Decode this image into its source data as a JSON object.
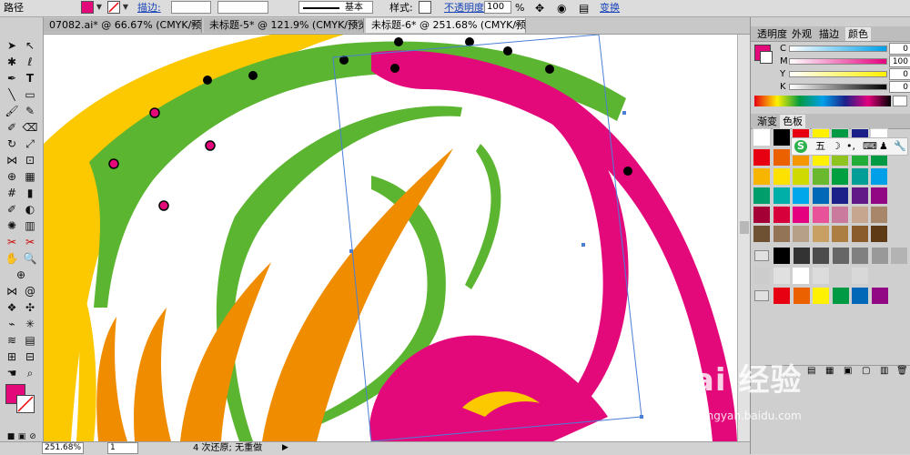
{
  "control_bar": {
    "object_type": "路径",
    "fill_color": "#e4097b",
    "stroke_label": "描边:",
    "stroke_preset": "基本",
    "style_label": "样式:",
    "opacity_label": "不透明度:",
    "opacity_value": "100",
    "opacity_unit": "%",
    "transform_label": "变换"
  },
  "tabs": [
    {
      "label": "07082.ai* @ 66.67% (CMYK/预览)",
      "active": false
    },
    {
      "label": "未标题-5* @ 121.9% (CMYK/预览)",
      "active": false
    },
    {
      "label": "未标题-6* @ 251.68% (CMYK/预览)",
      "active": true
    }
  ],
  "tab_close": "×",
  "status_bar": {
    "zoom": "251.68%",
    "page": "1",
    "message": "4 次还原; 无重做"
  },
  "panels": {
    "top_tabs": [
      "透明度",
      "外观",
      "描边",
      "颜色"
    ],
    "cmyk": [
      {
        "label": "C",
        "value": "0",
        "color": "#00a0e9"
      },
      {
        "label": "M",
        "value": "100",
        "color": "#e4007f"
      },
      {
        "label": "Y",
        "value": "0",
        "color": "#fff100"
      },
      {
        "label": "K",
        "value": "0",
        "color": "#000000"
      }
    ],
    "swatch_tabs": [
      "渐变",
      "色板"
    ],
    "ime": {
      "logo": "S",
      "mode": "五"
    }
  },
  "swatches": {
    "row1": [
      "#ffffff",
      "#000000",
      "#e60012",
      "#fff100",
      "#009944",
      "#1d2088",
      "#ffffff"
    ],
    "grid": [
      [
        "#e60012",
        "#eb6100",
        "#f39800",
        "#fff100",
        "#8fc31f",
        "#22ac38",
        "#009944"
      ],
      [
        "#f8b500",
        "#ffe100",
        "#cfdb00",
        "#6ab82e",
        "#00a040",
        "#009e96",
        "#00a0e9"
      ],
      [
        "#009e6b",
        "#00b0a8",
        "#00a7ea",
        "#0068b7",
        "#1d2088",
        "#601986",
        "#920783"
      ],
      [
        "#a40035",
        "#d7003a",
        "#e4007f",
        "#e85298",
        "#ca7a9c",
        "#c7a68f",
        "#a8866a"
      ],
      [
        "#6e5133",
        "#937456",
        "#b7a088",
        "#c9a063",
        "#ad7e43",
        "#8a5c2c",
        "#5e3a17"
      ]
    ],
    "grays": [
      "#000000",
      "#333333",
      "#4c4c4c",
      "#666666",
      "#808080",
      "#999999",
      "#b3b3b3"
    ],
    "grays2": [
      "#cccccc",
      "#e0e0e0",
      "#ffffff",
      "#dcdcdc",
      "#cfcfcf",
      "#d8d8d8"
    ],
    "brights": [
      "#e60012",
      "#eb6100",
      "#fff100",
      "#009944",
      "#0068b7",
      "#920783"
    ]
  },
  "watermark": {
    "text": "Bai 经验",
    "sub": "jingyan.baidu.com"
  },
  "art_colors": {
    "yellow": "#fcc800",
    "orange": "#f08c00",
    "green": "#5cb531",
    "magenta": "#e4097b",
    "selection": "#4a7fd6"
  }
}
